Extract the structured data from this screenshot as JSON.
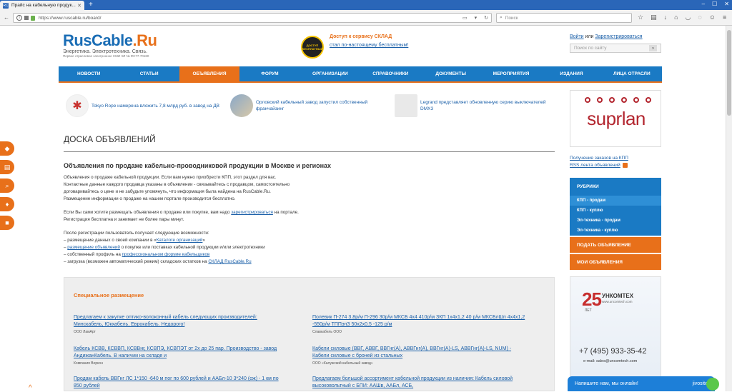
{
  "browser": {
    "tab_title": "Прайс на кабельную продук...",
    "tab_favicon": "RC",
    "new_tab": "+",
    "url": "https://www.ruscable.ru/board/",
    "search_placeholder": "Поиск",
    "window_buttons": [
      "–",
      "☐",
      "✕"
    ],
    "toolbar_icons": [
      "star-icon",
      "clipboard-icon",
      "download-icon",
      "home-icon",
      "pocket-icon",
      "chat-icon",
      "smile-icon",
      "menu-icon"
    ]
  },
  "header": {
    "logo_main": "RusCable",
    "logo_suffix": ".Ru",
    "logo_tagline": "Энергетика. Электротехника. Связь.",
    "logo_sub": "Первое отраслевое электронное СМИ ЭЛ № ФС77-70180",
    "promo_badge": "ДОСТУП БЕСПЛАТНЫЙ",
    "promo_title": "Доступ к сервису СКЛАД",
    "promo_link": "стал по-настоящему бесплатным!",
    "login": "Войти",
    "or": "или",
    "register": "Зарегистрироваться",
    "search_placeholder": "Поиск по сайту",
    "search_go": "»"
  },
  "nav": {
    "items": [
      "НОВОСТИ",
      "СТАТЬИ",
      "ОБЪЯВЛЕНИЯ",
      "ФОРУМ",
      "ОРГАНИЗАЦИИ",
      "СПРАВОЧНИКИ",
      "ДОКУМЕНТЫ",
      "МЕРОПРИЯТИЯ",
      "ИЗДАНИЯ",
      "ЛИЦА ОТРАСЛИ"
    ],
    "active_index": 2
  },
  "news": [
    {
      "text": "Tokyo Rope намерена вложить 7,8 млрд руб. в завод на ДВ"
    },
    {
      "text": "Орловский кабельный завод запустил собственный франчайзинг"
    },
    {
      "text": "Legrand представляет обновленную серию выключателей DMX3"
    }
  ],
  "content": {
    "title": "ДОСКА ОБЪЯВЛЕНИЙ",
    "subtitle": "Объявления по продаже кабельно-проводниковой продукции в Москве и регионах",
    "p1": [
      "Объявления о продаже кабельной продукции. Если вам нужно приобрести КПП, этот раздел для вас.",
      "Контактные данные каждого продавца указаны в объявлении - связывайтесь с продавцом, самостоятельно",
      "договаривайтесь о цене и не забудьте упомянуть, что информация была найдена на RusCable.Ru.",
      "Размещение информации о продаже на нашем портале производится бесплатно."
    ],
    "p2_pre": "Если Вы сами хотите размещать объявления о продаже или покупке, вам надо ",
    "p2_link": "зарегистрироваться",
    "p2_post": " на портале.",
    "p2_line2": "Регистрация бесплатна и занимает не более пары минут.",
    "p3_intro": "После регистрации пользователь получает следующие возможности:",
    "p3_l1_pre": "– размещение данных о своей компании в «",
    "p3_l1_link": "Каталоге организаций",
    "p3_l1_post": "»",
    "p3_l2_pre": "– ",
    "p3_l2_link": "размещение объявлений",
    "p3_l2_post": " о покупке или поставках кабельной продукции и/или электротехники",
    "p3_l3_pre": "– собственный профиль на ",
    "p3_l3_link": "профессиональном форуме кабельщиков",
    "p3_l4_pre": "– загрузка (возможен автоматический режим) складских остатков на ",
    "p3_l4_link": "СКЛАД RusCable.Ru"
  },
  "special": {
    "title": "Специальное размещение",
    "ads": [
      {
        "text": "Предлагаем к закупке оптико-волоконный кабель следующих производителей: Минскабель, Юкхабель, Еврокабель. Недорого!",
        "company": "ООО ЛамАрт"
      },
      {
        "text": "Полевик П-274 3,8р/м П-296 30р/м МКСБ 4х4 410р/м ЗКП 1х4х1,2 40 р/м МКСБлШп 4х4х1,2 -550р/м ТППэпЗ 50х2х0,5 -125 р/м",
        "company": "Славкабель ООО"
      },
      {
        "text": "Кабель КСВВ, КСВВП, КСВВнг, КСВПЭ, КСВПЭТ от 2х до 25 пар. Производство - завод АндижанКабель. В наличии на складе и",
        "company": "Компания Веркон"
      },
      {
        "text": "Кабели силовые (ВВГ, АВВГ, ВВГнг(А), АВВГнг(А), ВВГнг(А)-LS, АВВГнг(А)-LS, NUM) - Кабели силовые с броней из стальных",
        "company": "ООО «Калужский кабельный завод»"
      },
      {
        "text": "Продам кабель ВВГнг ЛС 1*150 -640 м пог по 600 рублей и ААБл-10 3*240 (ож) - 1 км по 850 рублей",
        "company": ""
      },
      {
        "text": "Предлагаем большой ассортимент кабельной продукции из наличия: Кабель силовой высоковольтный с БПИ: ААШв, ААБл, АСБ,",
        "company": ""
      }
    ]
  },
  "sidebar": {
    "suprlan": "suprlan",
    "link1": "Получение заказов на КПП",
    "link2": "RSS лента объявлений",
    "rubrics_title": "РУБРИКИ",
    "rubrics": [
      "КПП - продам",
      "КПП - куплю",
      "Эл-техника - продам",
      "Эл-техника - куплю"
    ],
    "rubric_selected": 0,
    "btn_add": "ПОДАТЬ ОБЪЯВЛЕНИЕ",
    "btn_my": "МОИ ОБЪЯВЛЕНИЯ",
    "uncomtech_years": "25",
    "uncomtech_years_label": "ЛЕТ",
    "uncomtech_name": "УНКОМТЕХ",
    "uncomtech_site": "www.uncomtech.com",
    "uncomtech_phone": "+7 (495) 933-35-42",
    "uncomtech_email": "e-mail: sales@uncomtech.com"
  },
  "chat": {
    "text": "Напишите нам, мы онлайн!",
    "brand": "jivosite"
  },
  "side_icons": [
    "cube-icon",
    "catalog-icon",
    "search-doc-icon",
    "tag-icon",
    "box-icon"
  ],
  "colors": {
    "brand_blue": "#1a7ac4",
    "accent_orange": "#e8701a",
    "link": "#1a5fa8"
  }
}
